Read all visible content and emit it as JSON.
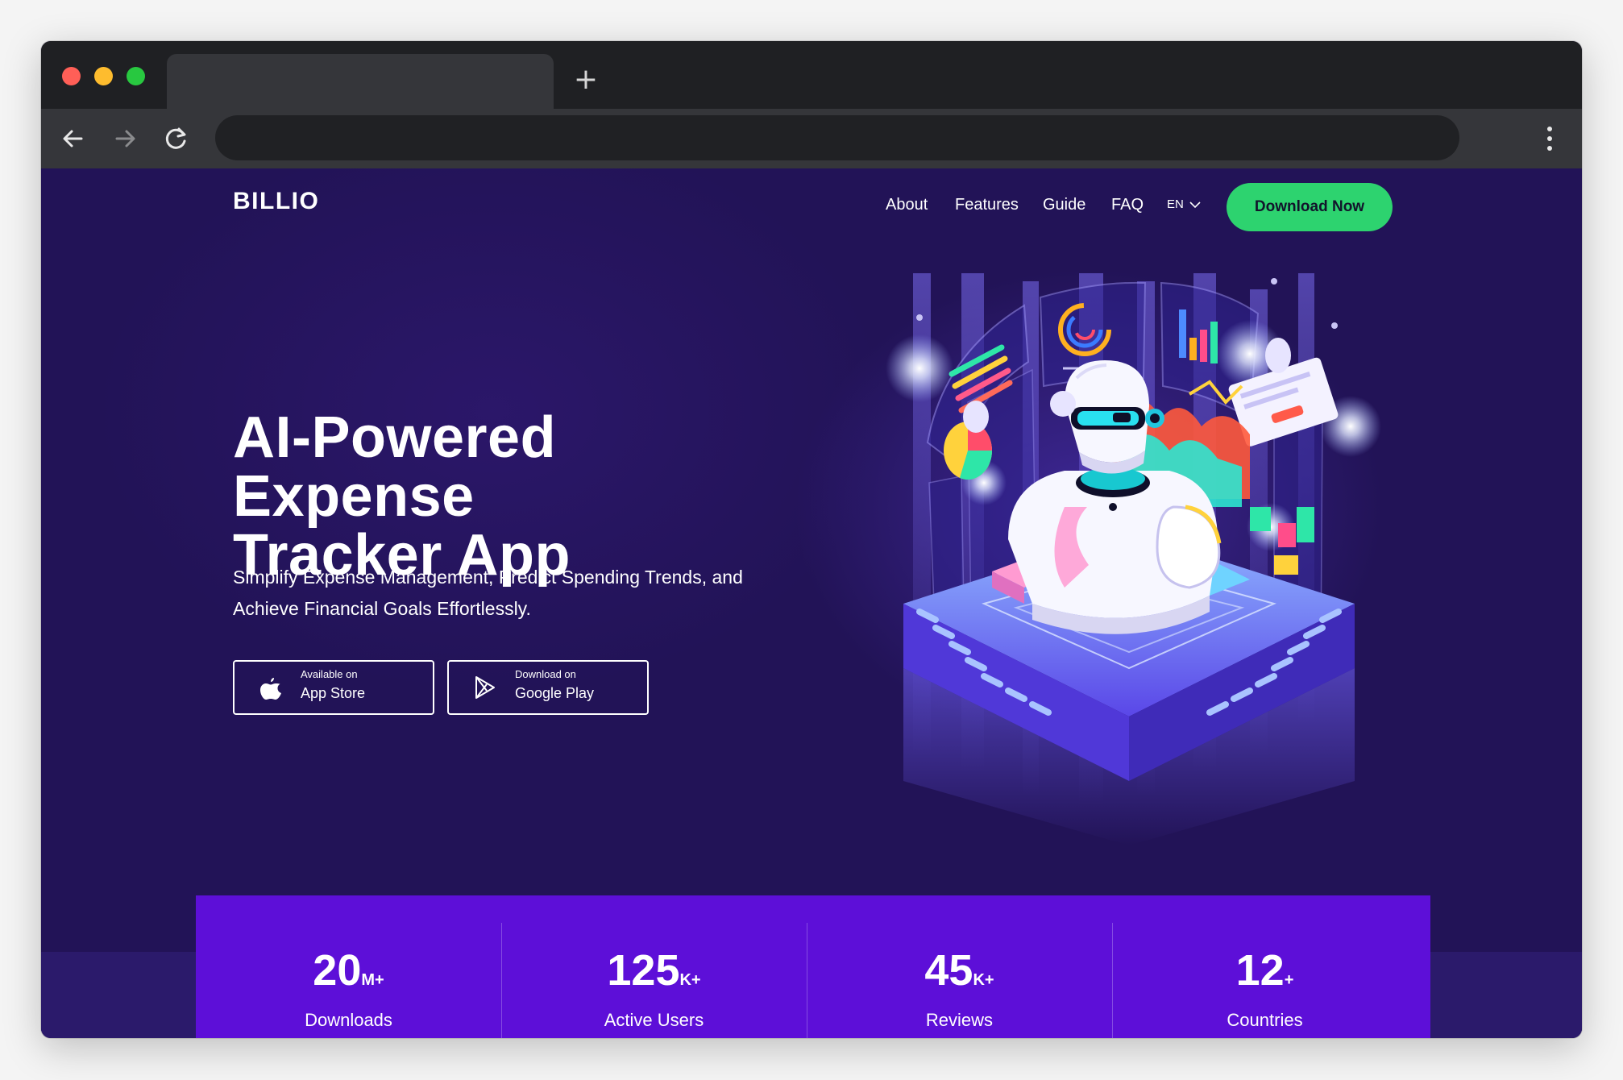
{
  "browser": {
    "new_tab": "+",
    "address": ""
  },
  "header": {
    "logo": "BILLIO",
    "nav": [
      "About",
      "Features",
      "Guide",
      "FAQ"
    ],
    "language": "EN",
    "cta_label": "Download Now"
  },
  "hero": {
    "title_line1": "AI-Powered Expense",
    "title_line2": "Tracker App",
    "subtitle_line1": "Simplify Expense Management, Predict Spending Trends, and",
    "subtitle_line2": "Achieve Financial Goals Effortlessly.",
    "app_store": {
      "small": "Available on",
      "big": "App Store"
    },
    "google_play": {
      "small": "Download on",
      "big": "Google Play"
    }
  },
  "stats": [
    {
      "value": "20",
      "suffix": "M+",
      "label": "Downloads"
    },
    {
      "value": "125",
      "suffix": "K+",
      "label": "Active Users"
    },
    {
      "value": "45",
      "suffix": "K+",
      "label": "Reviews"
    },
    {
      "value": "12",
      "suffix": "+",
      "label": "Countries"
    }
  ],
  "colors": {
    "page_background": "#221357",
    "accent_green": "#2dd36f",
    "stats_background": "#5d0fd8"
  }
}
